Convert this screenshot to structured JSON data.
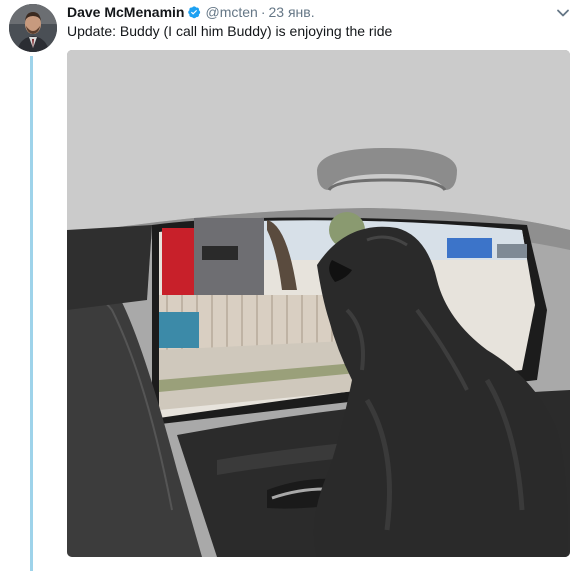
{
  "author": {
    "name": "Dave McMenamin",
    "handle": "@mcten",
    "date": "23 янв."
  },
  "header": {
    "separator": "·"
  },
  "tweet": {
    "text": "Update: Buddy (I call him Buddy) is enjoying the ride"
  },
  "icons": {
    "verified": "verified-badge-icon",
    "menu": "chevron-down-icon"
  },
  "colors": {
    "thread_line": "#9ed3ea",
    "verified": "#1da1f2",
    "secondary_text": "#657786",
    "primary_text": "#14171a"
  }
}
